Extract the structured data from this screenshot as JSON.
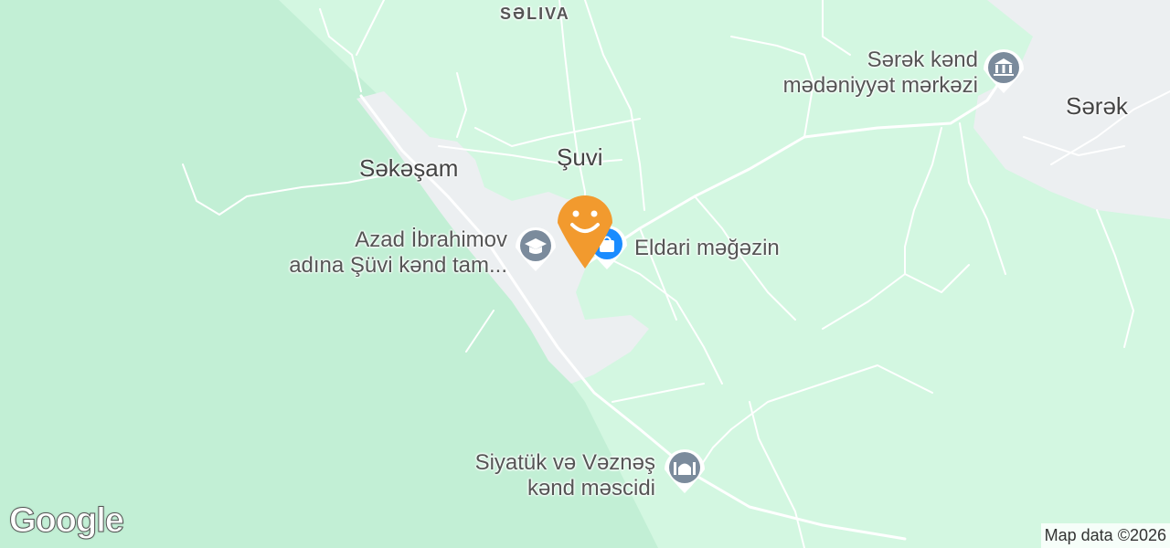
{
  "map": {
    "background_color": "#d3f7e1",
    "forest_color": "#c2efd5",
    "settlement_color": "#eceff1",
    "road_color": "#ffffff"
  },
  "places": {
    "saliva": "SƏLIVA",
    "suvi": "Şuvi",
    "sakasam": "Səkəşam",
    "sarak": "Sərək"
  },
  "pois": {
    "culture_center": {
      "line1": "Sərək kənd",
      "line2": "mədəniyyət mərkəzi",
      "icon": "museum-icon"
    },
    "school": {
      "line1": "Azad İbrahimov",
      "line2": "adına Şüvi kənd tam...",
      "icon": "school-icon"
    },
    "shop": {
      "line1": "Eldari məğəzin",
      "icon": "shopping-bag-icon"
    },
    "mosque": {
      "line1": "Siyatük və Vəznəş",
      "line2": "kənd məscidi",
      "icon": "mosque-icon"
    }
  },
  "pin": {
    "icon": "smiley-face-icon",
    "color": "#f29a2e"
  },
  "attribution": "Map data ©2026",
  "logo": "Google"
}
